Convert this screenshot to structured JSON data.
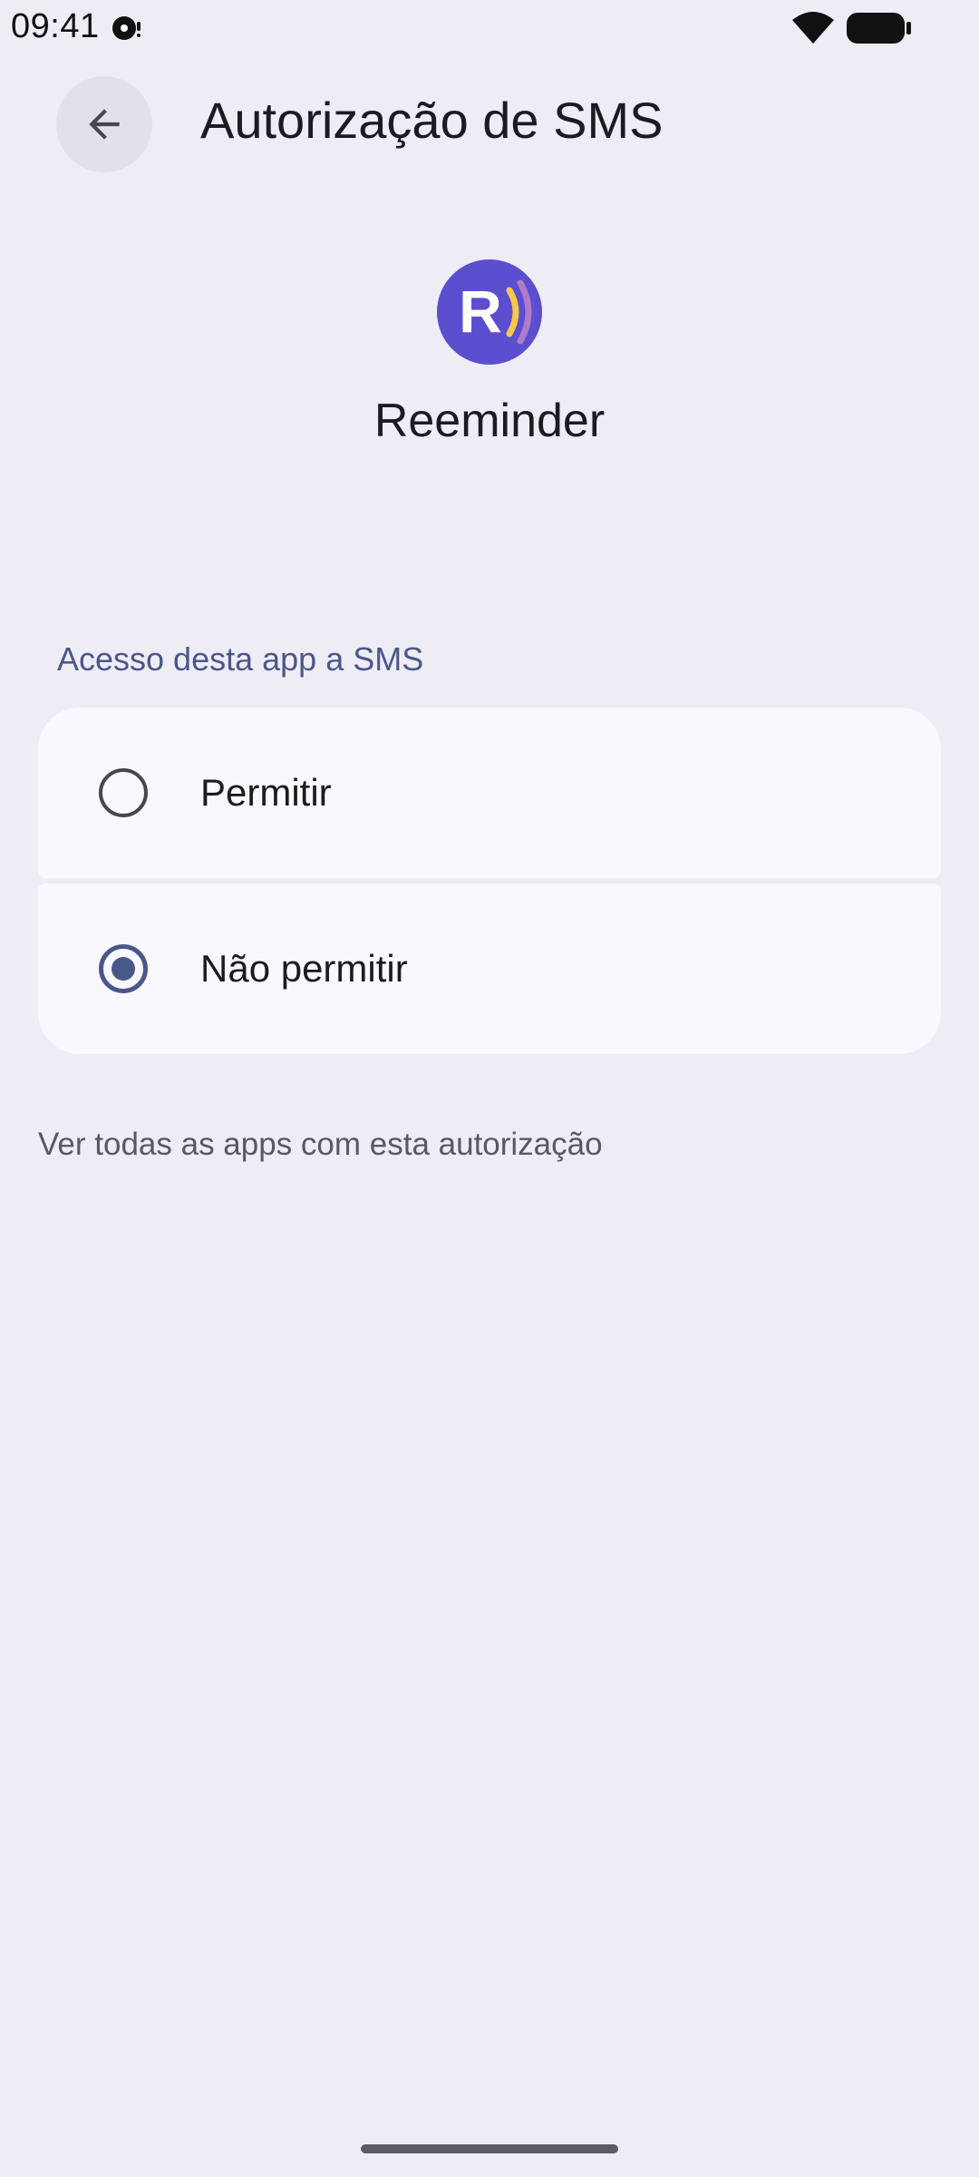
{
  "status_bar": {
    "time": "09:41",
    "notification_icon": "podcast-icon",
    "wifi_icon": "wifi-icon",
    "battery_icon": "battery-full-icon"
  },
  "header": {
    "back_icon": "arrow-back-icon",
    "title": "Autorização de SMS"
  },
  "app": {
    "icon": "reeminder-app-icon",
    "name": "Reeminder",
    "icon_colors": {
      "background": "#5b4fcf",
      "letter": "#ffffff",
      "wave_inner": "#f6c84c",
      "wave_outer": "#b07cc9"
    }
  },
  "permission": {
    "section_label": "Acesso desta app a SMS",
    "options": [
      {
        "label": "Permitir",
        "selected": false
      },
      {
        "label": "Não permitir",
        "selected": true
      }
    ],
    "see_all_link": "Ver todas as apps com esta autorização"
  },
  "colors": {
    "background": "#eeedf6",
    "card": "#f9f8fe",
    "accent": "#4a5789",
    "text_primary": "#1d1b22",
    "text_secondary": "#5a5862"
  }
}
